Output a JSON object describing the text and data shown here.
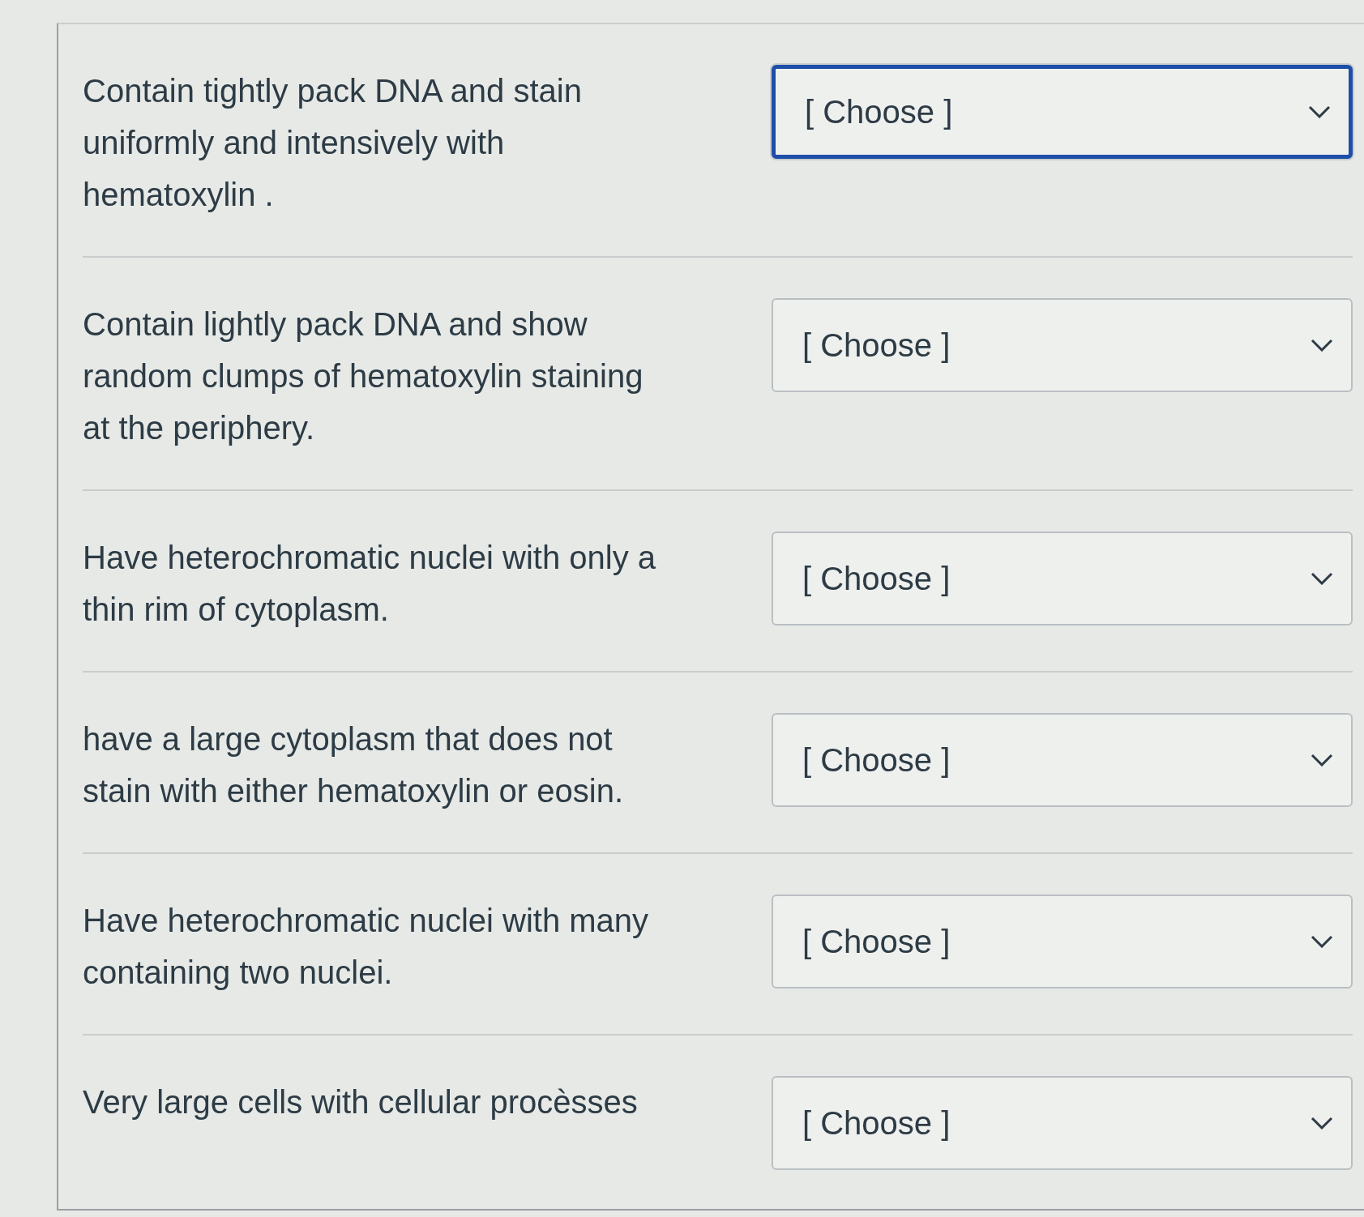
{
  "questions": [
    {
      "prompt": "Contain tightly pack DNA and stain uniformly and intensively with hematoxylin .",
      "dropdown": {
        "value": "[ Choose ]",
        "focused": true
      }
    },
    {
      "prompt": "Contain lightly pack DNA and show random clumps of hematoxylin staining at the periphery.",
      "dropdown": {
        "value": "[ Choose ]",
        "focused": false
      }
    },
    {
      "prompt": "Have heterochromatic nuclei with only a thin rim of cytoplasm.",
      "dropdown": {
        "value": "[ Choose ]",
        "focused": false
      }
    },
    {
      "prompt": "have a large cytoplasm that does not stain with either hematoxylin or eosin.",
      "dropdown": {
        "value": "[ Choose ]",
        "focused": false
      }
    },
    {
      "prompt": "Have heterochromatic nuclei with many containing two nuclei.",
      "dropdown": {
        "value": "[ Choose ]",
        "focused": false
      }
    },
    {
      "prompt": "Very large cells with cellular procèsses",
      "dropdown": {
        "value": "[ Choose ]",
        "focused": false
      }
    }
  ]
}
